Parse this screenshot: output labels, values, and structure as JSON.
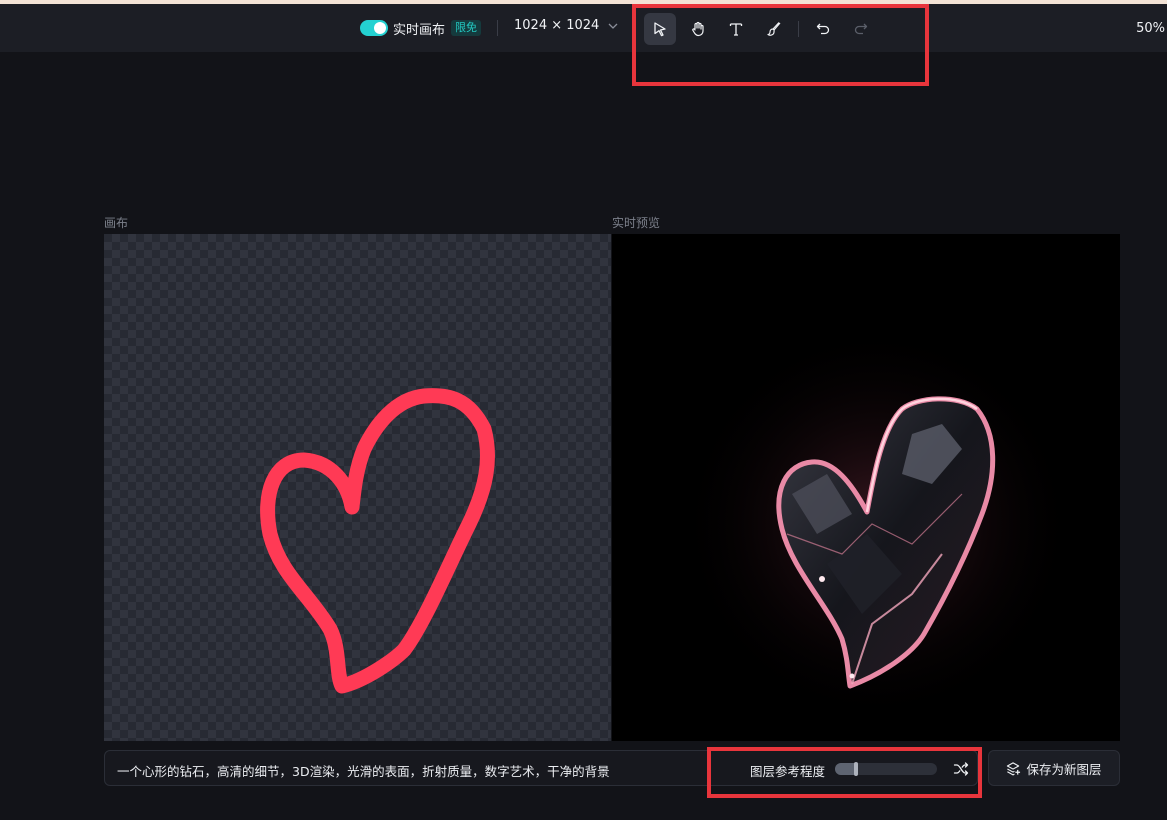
{
  "toolbar": {
    "realtime_toggle": {
      "label": "实时画布",
      "on": true,
      "badge": "限免"
    },
    "canvas_size": "1024 × 1024",
    "tools": [
      {
        "name": "select",
        "icon": "cursor-arrow-icon",
        "active": true
      },
      {
        "name": "hand",
        "icon": "hand-icon",
        "active": false
      },
      {
        "name": "text",
        "icon": "text-t-icon",
        "active": false
      },
      {
        "name": "brush",
        "icon": "brush-icon",
        "active": false
      },
      {
        "name": "undo",
        "icon": "undo-icon",
        "enabled": true
      },
      {
        "name": "redo",
        "icon": "redo-icon",
        "enabled": false
      }
    ],
    "zoom": "50%"
  },
  "panels": {
    "canvas_label": "画布",
    "preview_label": "实时预览"
  },
  "bottom": {
    "prompt": "一个心形的钻石，高清的细节，3D渲染，光滑的表面，折射质量，数字艺术，干净的背景",
    "strength_label": "图层参考程度",
    "strength_value": 0.21,
    "save_button": "保存为新图层"
  },
  "colors": {
    "accent": "#24d1d1",
    "sketch_stroke": "#ff3a55",
    "highlight": "#e8353c"
  }
}
